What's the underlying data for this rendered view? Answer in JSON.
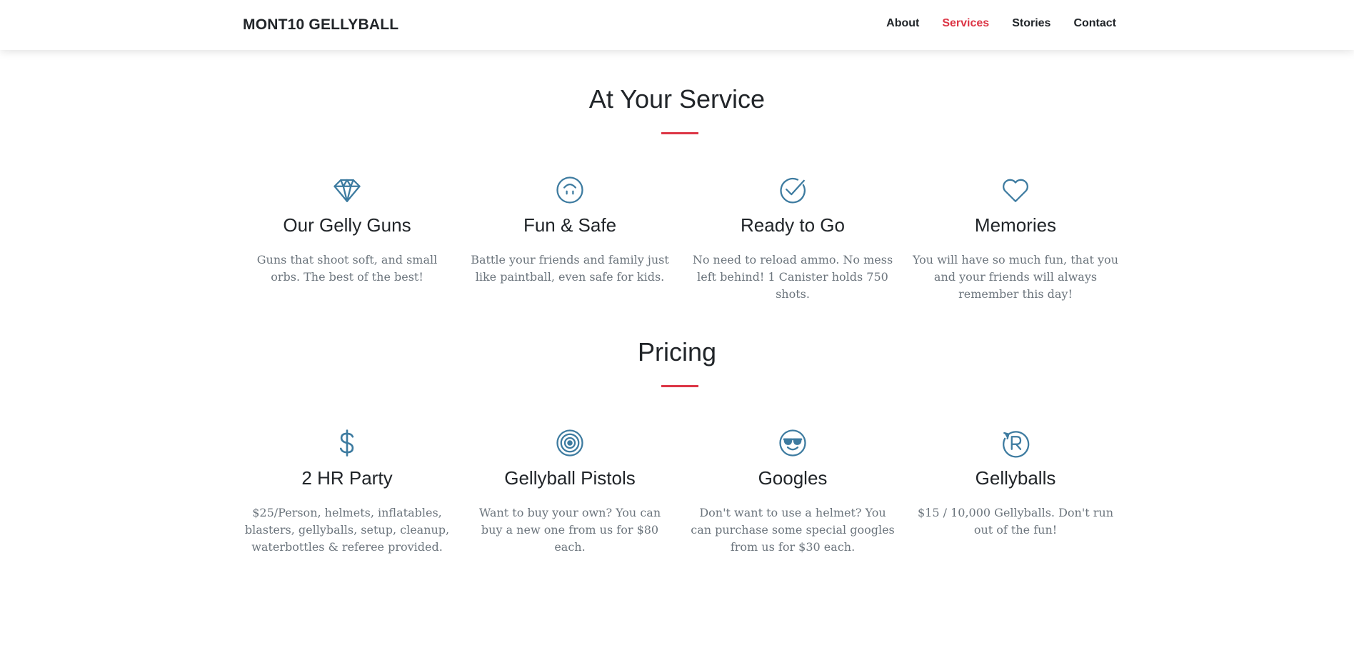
{
  "nav": {
    "brand": "MONT10 GELLYBALL",
    "links": [
      {
        "label": "About",
        "active": false
      },
      {
        "label": "Services",
        "active": true
      },
      {
        "label": "Stories",
        "active": false
      },
      {
        "label": "Contact",
        "active": false
      }
    ],
    "active_color": "#dc3545"
  },
  "colors": {
    "accent": "#dc3545",
    "icon": "#3d7ba0",
    "text": "#212529",
    "muted": "#6c757d"
  },
  "services": {
    "title": "At Your Service",
    "items": [
      {
        "icon": "diamond-icon",
        "title": "Our Gelly Guns",
        "text": "Guns that shoot soft, and small orbs. The best of the best!"
      },
      {
        "icon": "smiley-icon",
        "title": "Fun & Safe",
        "text": "Battle your friends and family just like paintball, even safe for kids."
      },
      {
        "icon": "check-icon",
        "title": "Ready to Go",
        "text": "No need to reload ammo. No mess left behind! 1 Canister holds 750 shots."
      },
      {
        "icon": "heart-icon",
        "title": "Memories",
        "text": "You will have so much fun, that you and your friends will always remember this day!"
      }
    ]
  },
  "pricing": {
    "title": "Pricing",
    "items": [
      {
        "icon": "dollar-icon",
        "title": "2 HR Party",
        "text": "$25/Person, helmets, inflatables, blasters, gellyballs, setup, cleanup, waterbottles & referee provided."
      },
      {
        "icon": "target-icon",
        "title": "Gellyball Pistols",
        "text": "Want to buy your own? You can buy a new one from us for $80 each."
      },
      {
        "icon": "sunglasses-smiley-icon",
        "title": "Googles",
        "text": "Don't want to use a helmet? You can purchase some special googles from us for $30 each."
      },
      {
        "icon": "registered-refresh-icon",
        "title": "Gellyballs",
        "text": "$15 / 10,000 Gellyballs. Don't run out of the fun!"
      }
    ]
  }
}
